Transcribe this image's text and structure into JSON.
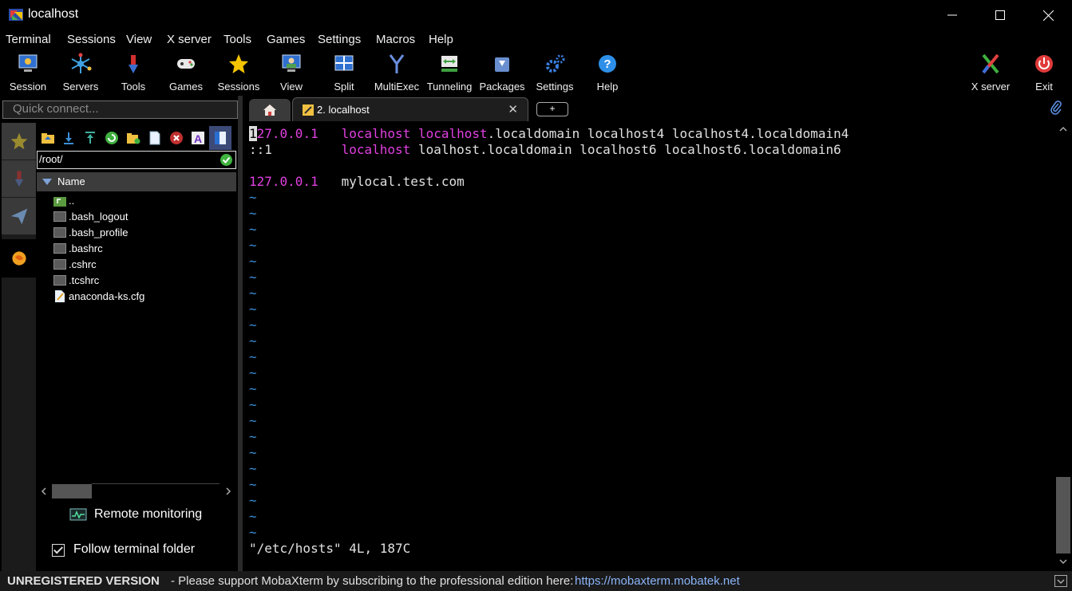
{
  "window": {
    "title": "localhost",
    "minimize": "—",
    "maximize": "☐",
    "close": "✕"
  },
  "menu": [
    "Terminal",
    "Sessions",
    "View",
    "X server",
    "Tools",
    "Games",
    "Settings",
    "Macros",
    "Help"
  ],
  "toolbar": {
    "items": [
      "Session",
      "Servers",
      "Tools",
      "Games",
      "Sessions",
      "View",
      "Split",
      "MultiExec",
      "Tunneling",
      "Packages",
      "Settings",
      "Help"
    ],
    "right_items": [
      "X server",
      "Exit"
    ]
  },
  "sidebar": {
    "quick_connect_placeholder": "Quick connect...",
    "path": "/root/",
    "column_header": "Name",
    "files": [
      "..",
      ".bash_logout",
      ".bash_profile",
      ".bashrc",
      ".cshrc",
      ".tcshrc",
      "anaconda-ks.cfg"
    ],
    "remote_monitoring": "Remote monitoring",
    "follow_terminal_folder": "Follow terminal folder",
    "follow_checked": true
  },
  "tabs": {
    "active_label": "2. localhost",
    "close_glyph": "✕",
    "new_tab_glyph": "+"
  },
  "terminal": {
    "line1_ip": "127.0.0.1",
    "line1_host": "localhost",
    "line1_host2": "localhost",
    "line1_rest": ".localdomain localhost4 localhost4.localdomain4",
    "line2_ip": "::1",
    "line2_host": "localhost",
    "line2_rest": " loalhost.localdomain localhost6 localhost6.localdomain6",
    "line4_ip": "127.0.0.1",
    "line4_host": "mylocal.test.com",
    "tilde": "~",
    "status": "\"/etc/hosts\" 4L, 187C"
  },
  "statusbar": {
    "version": "UNREGISTERED VERSION",
    "message": "-  Please support MobaXterm by subscribing to the professional edition here:",
    "link": "https://mobaxterm.mobatek.net"
  },
  "colors": {
    "terminal_magenta": "#e040e0",
    "tilde_blue": "#3a8fd8",
    "link_blue": "#8ab4f8"
  }
}
